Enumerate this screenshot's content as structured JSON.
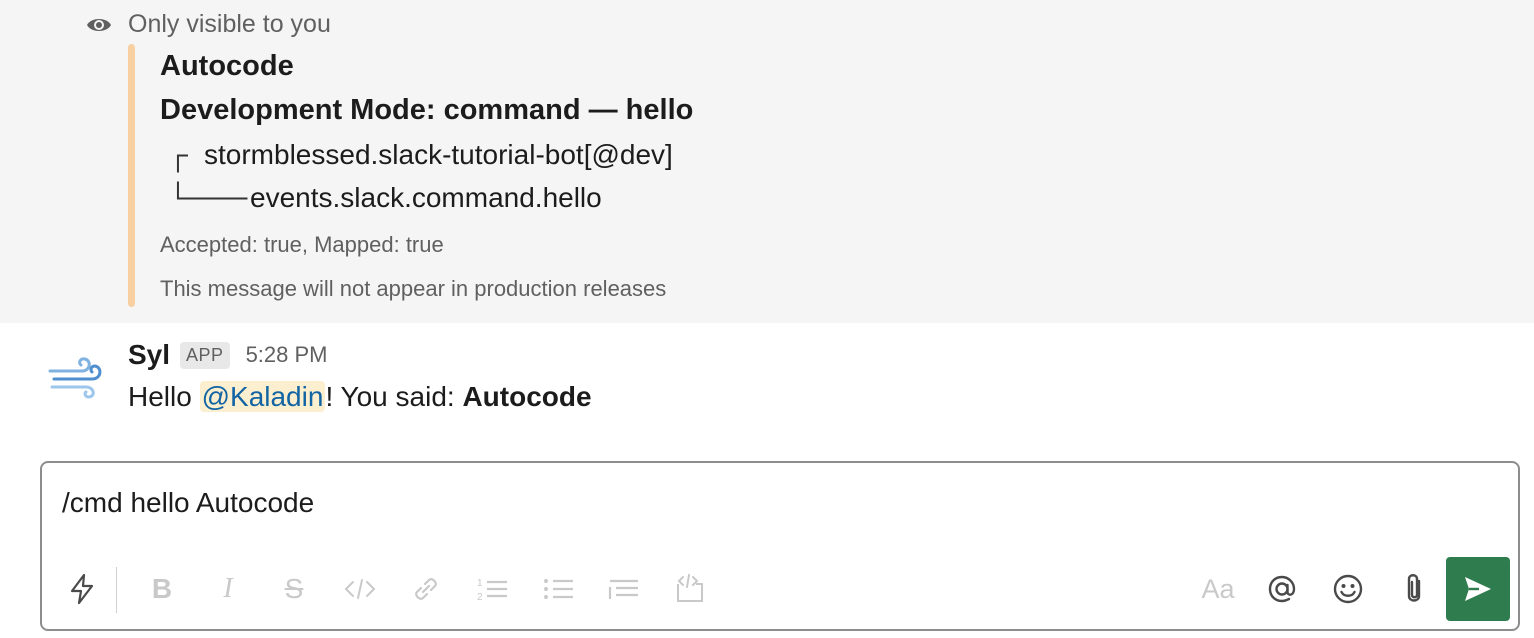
{
  "ephemeral": {
    "visibility_label": "Only visible to you",
    "attachment": {
      "title": "Autocode",
      "subtitle": "Development Mode: command — hello",
      "tree_root_glyph": "┌",
      "tree_root": "stormblessed.slack-tutorial-bot[@dev]",
      "tree_child_glyph": "└───",
      "tree_child": "events.slack.command.hello",
      "meta_status": "Accepted: true, Mapped: true",
      "meta_note": "This message will not appear in production releases",
      "accent_color": "#f7cfa0"
    }
  },
  "message": {
    "sender": "Syl",
    "badge": "APP",
    "time": "5:28 PM",
    "text_prefix": "Hello ",
    "mention": "@Kaladin",
    "text_middle": "! You said: ",
    "text_bold": "Autocode"
  },
  "composer": {
    "value": "/cmd hello Autocode",
    "send_color": "#2f7d4f",
    "toolbar_icons": [
      "shortcuts-icon",
      "bold-icon",
      "italic-icon",
      "strikethrough-icon",
      "code-icon",
      "link-icon",
      "numbered-list-icon",
      "bulleted-list-icon",
      "blockquote-icon",
      "code-block-icon",
      "formatting-icon",
      "mention-icon",
      "emoji-icon",
      "attachment-icon",
      "send-icon"
    ],
    "formatting_label": "Aa"
  }
}
